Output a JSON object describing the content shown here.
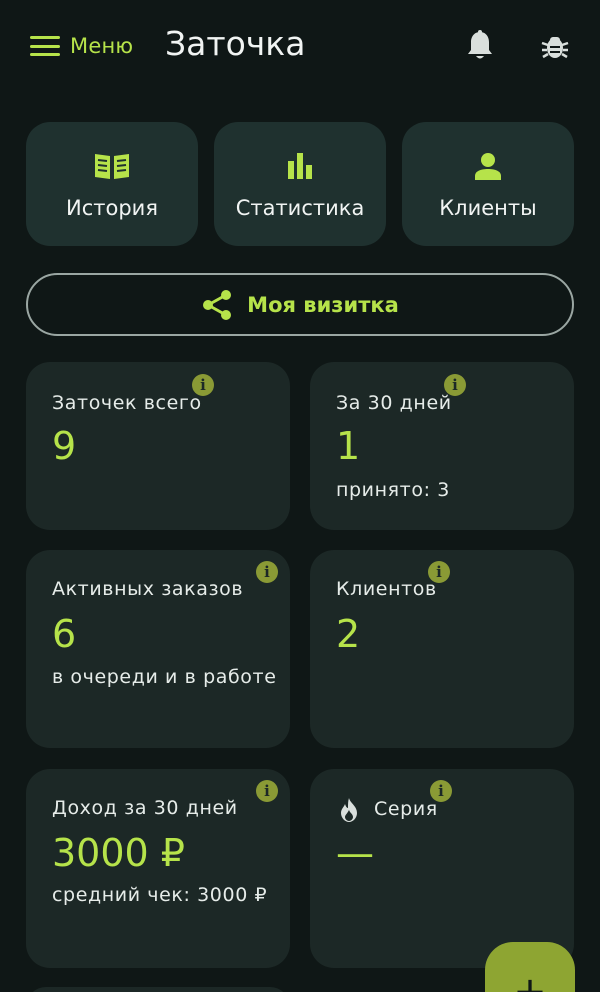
{
  "header": {
    "menu_label": "Меню",
    "title": "Заточка"
  },
  "nav": [
    {
      "label": "История",
      "icon": "book-open-icon"
    },
    {
      "label": "Статистика",
      "icon": "bar-chart-icon"
    },
    {
      "label": "Клиенты",
      "icon": "person-icon"
    }
  ],
  "business_card": {
    "label": "Моя визитка",
    "icon": "share-icon"
  },
  "stats": {
    "total": {
      "label": "Заточек всего",
      "value": "9"
    },
    "last30": {
      "label": "За 30 дней",
      "value": "1",
      "sub": "принято: 3"
    },
    "active": {
      "label": "Активных заказов",
      "value": "6",
      "sub": "в очереди и в работе"
    },
    "clients": {
      "label": "Клиентов",
      "value": "2"
    },
    "income": {
      "label": "Доход за 30 дней",
      "value": "3000 ₽",
      "sub": "средний чек: 3000 ₽"
    },
    "streak": {
      "label": "Серия",
      "value": "—"
    }
  },
  "info_symbol": "i",
  "fab_symbol": "+",
  "colors": {
    "accent": "#b6e34a",
    "background": "#0f1716",
    "card": "#1c2826",
    "tile": "#1f312f",
    "info_badge": "#8a9a35"
  }
}
